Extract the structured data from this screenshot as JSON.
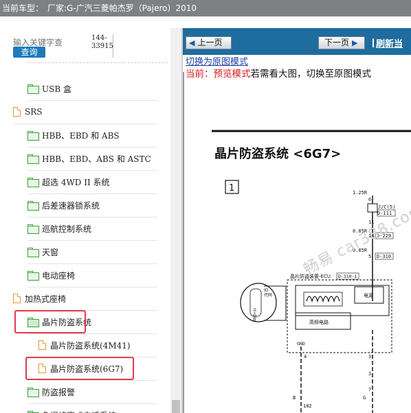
{
  "titlebar": {
    "label": "当前车型：",
    "vehicle": "厂家:G-广汽三菱帕杰罗（Pajero）2010"
  },
  "search": {
    "placeholder": "输入关键字查",
    "button_label": "查询",
    "code_line1": "144-",
    "code_line2": "33915"
  },
  "tree": [
    {
      "label": "USB 盒",
      "icon": "folder-icon",
      "level": 1
    },
    {
      "label": "SRS",
      "icon": "document-icon",
      "level": 0
    },
    {
      "label": "HBB、EBD 和 ABS",
      "icon": "folder-icon",
      "level": 1
    },
    {
      "label": "HBB、EBD、ABS 和 ASTC",
      "icon": "folder-icon",
      "level": 1
    },
    {
      "label": "超选 4WD II 系统",
      "icon": "folder-icon",
      "level": 1
    },
    {
      "label": "后差速器锁系统",
      "icon": "folder-icon",
      "level": 1
    },
    {
      "label": "巡航控制系统",
      "icon": "folder-icon",
      "level": 1
    },
    {
      "label": "天窗",
      "icon": "folder-icon",
      "level": 1
    },
    {
      "label": "电动座椅",
      "icon": "folder-icon",
      "level": 1
    },
    {
      "label": "加热式座椅",
      "icon": "document-icon",
      "level": 0
    },
    {
      "label": "晶片防盗系统",
      "icon": "folder-open-icon",
      "level": 1,
      "highlighted": true
    },
    {
      "label": "晶片防盗系统(4M41)",
      "icon": "document-icon",
      "level": 2
    },
    {
      "label": "晶片防盗系统(6G7)",
      "icon": "document-icon",
      "level": 2,
      "highlighted": true
    },
    {
      "label": "防盗报警",
      "icon": "folder-icon",
      "level": 1
    },
    {
      "label": "免提蜂窝式电话系统",
      "icon": "folder-icon",
      "level": 1
    }
  ],
  "viewer": {
    "prev_label": "上一页",
    "next_label": "下一页",
    "refresh_label": "刷新当",
    "switch_link": "切换为原图模式",
    "mode_prefix": "当前：",
    "mode_name": "预览模式",
    "mode_suffix": "若需看大图，切换至原图模式"
  },
  "diagram": {
    "title": "晶片防盗系统 <6G7>",
    "section_number": "1",
    "wire1": "1.25R",
    "pin6": "6",
    "jc_label": "J/C(5)",
    "jc_conn": "D-111",
    "pin11": "11",
    "wire2": "0.85R",
    "pin14": "14",
    "conn229": "D-229",
    "wire3": "0.85R",
    "pin5": "5",
    "conn310": "D-310",
    "ecu_label": "晶片防盗装置-ECU",
    "ecu_conn": "D-310-1",
    "key_id": "ID",
    "key_code": "代码",
    "key_label": "点火钥匙",
    "power_label": "电源",
    "hf_label": "高频电路",
    "gnd_label": "GND",
    "pin4": "4",
    "pin3a": "3",
    "pin3b": "3",
    "pin7": "7",
    "wireB": "B",
    "wireG": "G",
    "pin182": "182"
  },
  "watermark": {
    "text": "畅易 car388.com"
  },
  "colors": {
    "titlebar": "#7e8184",
    "navbar": "#1f6c9e",
    "search_button": "#1e7bbd",
    "highlight": "#e03a4a",
    "mode_red": "#d81a1a",
    "link": "#1b3fa8"
  }
}
